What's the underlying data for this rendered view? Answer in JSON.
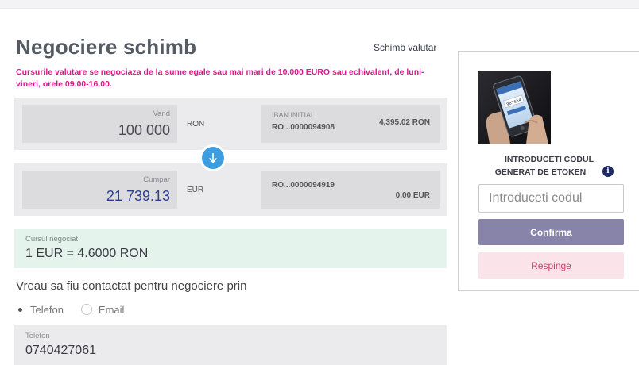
{
  "header": {
    "title": "Negociere schimb",
    "top_link": "Schimb valutar"
  },
  "notice": "Cursurile valutare se negociaza de la sume egale sau mai mari de 10.000 EURO sau echivalent, de luni-vineri, orele 09.00-16.00.",
  "sell": {
    "label": "Vand",
    "amount": "100 000",
    "currency": "RON",
    "account_label": "IBAN INITIAL",
    "account": "RO...0000094908",
    "balance": "4,395.02 RON"
  },
  "swap_icon": "arrow-down-icon",
  "buy": {
    "label": "Cumpar",
    "amount": "21 739.13",
    "currency": "EUR",
    "account": "RO...0000094919",
    "balance": "0.00 EUR"
  },
  "rate": {
    "label": "Cursul negociat",
    "value": "1 EUR = 4.6000 RON"
  },
  "contact": {
    "heading": "Vreau sa fiu contactat pentru negociere prin",
    "options": [
      "Telefon",
      "Email"
    ],
    "selected": "Telefon",
    "phone_label": "Telefon",
    "phone_value": "0740427061"
  },
  "token": {
    "title_line1": "INTRODUCETI CODUL",
    "title_line2": "GENERAT DE ETOKEN",
    "input_placeholder": "Introduceti codul",
    "confirm_label": "Confirma",
    "reject_label": "Respinge",
    "info_icon": "info-icon",
    "phone_screen_text": "987654"
  },
  "colors": {
    "notice": "#e0168f",
    "swap_button": "#3d9ddf",
    "rate_background": "#e4f3eb",
    "confirm_button": "#8783a9",
    "reject_button_bg": "#fbe3ea",
    "reject_text": "#d0436b",
    "buy_amount": "#2c3f8e"
  }
}
